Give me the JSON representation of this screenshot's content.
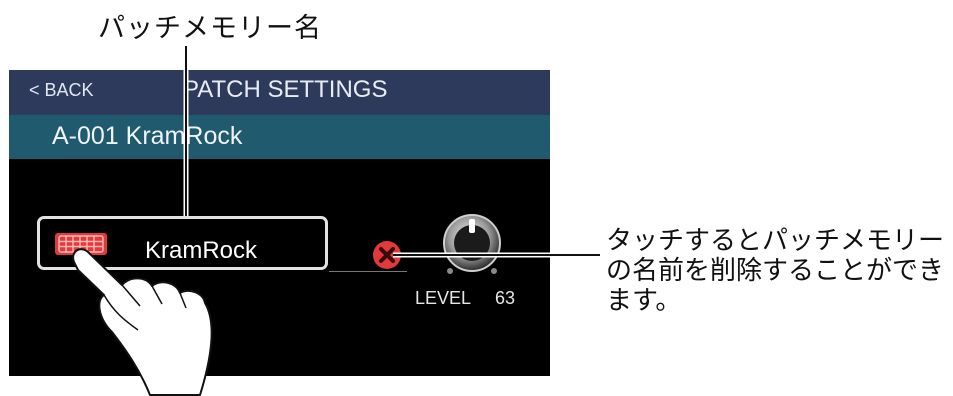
{
  "annotations": {
    "top_label": "パッチメモリー名",
    "right_label": "タッチするとパッチメモリーの名前を削除することができます。"
  },
  "screen": {
    "back_label": "< BACK",
    "title": "PATCH SETTINGS",
    "patch_id": "A-001 KramRock",
    "name_value": "KramRock",
    "level_label": "LEVEL",
    "level_value": "63"
  },
  "icons": {
    "keyboard": "keyboard-icon",
    "delete": "delete-x-icon",
    "level_knob": "knob-icon",
    "hand": "pointing-hand-icon"
  },
  "colors": {
    "title_bar": "#2d3a5c",
    "patch_bar": "#1f5a6e",
    "accent_red": "#e03a3a"
  }
}
